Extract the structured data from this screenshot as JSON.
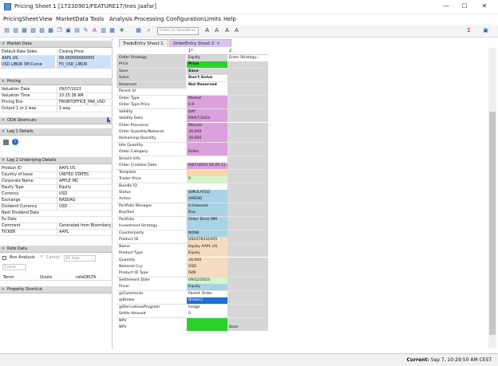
{
  "window": {
    "title": "Pricing Sheet 1 [17230901/FEATURE17/Ines Jaafar]",
    "min": "—",
    "max": "☐",
    "close": "✕"
  },
  "menu": [
    "PricingSheet",
    "View",
    "MarketData",
    "Tools",
    "Analysis",
    "Processing",
    "Configuration",
    "Limits",
    "Help"
  ],
  "toolbar": {
    "search_placeholder": "Order Id / Bundle Id"
  },
  "market_data": {
    "title": "Market Data",
    "header": {
      "k": "Default Rate Sides",
      "v": "Closing Price"
    },
    "rows": [
      {
        "k": "AAPL US",
        "v": "58.000000000000"
      },
      {
        "k": "USD LIBOR 3M Curve",
        "v": "F0_USD_LIBOR"
      }
    ]
  },
  "pricing": {
    "title": "Pricing",
    "rows": [
      {
        "k": "Valuation Date",
        "v": "09/07/2023"
      },
      {
        "k": "Valuation Time",
        "v": "10:25:38 AM"
      },
      {
        "k": "Pricing Env",
        "v": "FRONTOFFICE_PAR_USD"
      },
      {
        "k": "Output 1 or 2 way",
        "v": "1-way"
      }
    ]
  },
  "oda": {
    "title": "ODA Shortcuts"
  },
  "leg1": {
    "title": "Leg 1 Details"
  },
  "leg1u": {
    "title": "Leg 1 Underlying Details",
    "rows": [
      {
        "k": "Product ID",
        "v": "AAPL US"
      },
      {
        "k": "Country of Issue",
        "v": "UNITED STATES"
      },
      {
        "k": "Corporate Name",
        "v": "APPLE INC"
      },
      {
        "k": "Equity Type",
        "v": "Equity"
      },
      {
        "k": "Currency",
        "v": "USD"
      },
      {
        "k": "Exchange",
        "v": "NASDAQ"
      },
      {
        "k": "Dividend Currency",
        "v": "USD"
      },
      {
        "k": "Next Dividend Date",
        "v": ""
      },
      {
        "k": "Ex Date",
        "v": ""
      },
      {
        "k": "Comment",
        "v": "Generated from Bloomberg..."
      },
      {
        "k": "TICKER",
        "v": "AAPL"
      }
    ]
  },
  "rate_data": {
    "title": "Rate Data",
    "run_analysis": "Run Analysis",
    "cancel": "Cancel",
    "all_legs": "All legs",
    "curve": "Curve",
    "cols": [
      "Tenor",
      "Quote",
      "rateDELTA"
    ]
  },
  "property_shortcut": {
    "title": "Property Shortcut"
  },
  "tabs": [
    {
      "label": "TradeEntry Sheet 1"
    },
    {
      "label": "OrderEntry Sheet 2"
    }
  ],
  "grid_header": {
    "c1": "1*",
    "c2": "2"
  },
  "rows": [
    {
      "label": "Order Strategy",
      "value": "Equity",
      "extra": "Enter Strategy..."
    },
    {
      "label": "Price",
      "value": "Price",
      "extra": ""
    },
    {
      "label": "Save",
      "value": "Save",
      "extra": ""
    },
    {
      "label": "Solve",
      "value": "Don't Solve",
      "extra": ""
    },
    {
      "label": "Reserved",
      "value": "Not Reserved",
      "extra": ""
    },
    {
      "label": "Parent Id",
      "value": "",
      "extra": ""
    },
    {
      "label": "Order Type",
      "value": "Market",
      "extra": ""
    },
    {
      "label": "Order Type Price",
      "value": "0.0",
      "extra": ""
    },
    {
      "label": "Validity",
      "value": "DAY",
      "extra": ""
    },
    {
      "label": "Validity Date",
      "value": "09/07/2023",
      "extra": ""
    },
    {
      "label": "Order Processor",
      "value": "Manual",
      "extra": ""
    },
    {
      "label": "Order Quantity/Notional",
      "value": "30,000",
      "extra": ""
    },
    {
      "label": "Remaining Quantity",
      "value": "30,000",
      "extra": ""
    },
    {
      "label": "Idle Quantity",
      "value": "",
      "extra": ""
    },
    {
      "label": "Order Category",
      "value": "Order",
      "extra": ""
    },
    {
      "label": "Breach Info",
      "value": "",
      "extra": ""
    },
    {
      "label": "Order Creation Date",
      "value": "9/07/2023 10:25:11 AM",
      "extra": ""
    },
    {
      "label": "Template",
      "value": "",
      "extra": ""
    },
    {
      "label": "Trader Price",
      "value": "0",
      "extra": ""
    },
    {
      "label": "Bundle ID",
      "value": "",
      "extra": ""
    },
    {
      "label": "Status",
      "value": "SIMULATED",
      "extra": ""
    },
    {
      "label": "Action",
      "value": "AMEND",
      "extra": ""
    },
    {
      "label": "Portfolio Manager",
      "value": "O Edwards",
      "extra": ""
    },
    {
      "label": "Buy/Sell",
      "value": "Buy",
      "extra": ""
    },
    {
      "label": "Portfolio",
      "value": "Order Book MM",
      "extra": ""
    },
    {
      "label": "Investment Strategy",
      "value": "",
      "extra": ""
    },
    {
      "label": "Counterparty",
      "value": "NONE",
      "extra": ""
    },
    {
      "label": "Product ID",
      "value": "US0378331005",
      "extra": ""
    },
    {
      "label": "Name",
      "value": "Equity AAPL US",
      "extra": ""
    },
    {
      "label": "Product Type",
      "value": "Equity",
      "extra": ""
    },
    {
      "label": "Quantity",
      "value": "30,000",
      "extra": ""
    },
    {
      "label": "Notional Ccy",
      "value": "USD",
      "extra": ""
    },
    {
      "label": "Product ID Type",
      "value": "ISIN",
      "extra": ""
    },
    {
      "label": "Settlement Date",
      "value": "09/12/2023",
      "extra": ""
    },
    {
      "label": "Pricer",
      "value": "Equity",
      "extra": ""
    },
    {
      "label": "@Comments",
      "value": "Parent Order",
      "extra": ""
    },
    {
      "label": "@Broker",
      "value": "Broker2",
      "extra": ""
    },
    {
      "label": "@DerivativesProgram",
      "value": "hedge",
      "extra": ""
    },
    {
      "label": "Settle Amount",
      "value": "0",
      "extra": ""
    },
    {
      "label": "NPV",
      "value": "",
      "extra": ""
    },
    {
      "label": "NPV",
      "value": "",
      "extra": "Base"
    }
  ],
  "row_colors": [
    "#d6d6d6",
    "#2bd12b",
    "#d6d6d6",
    "#ffffff",
    "#ffffff",
    "#ffffff",
    "#dca0dc",
    "#dca0dc",
    "#dca0dc",
    "#dca0dc",
    "#dca0dc",
    "#dca0dc",
    "#dca0dc",
    "#dca0dc",
    "#dca0dc",
    "#ffffff",
    "#dca0dc",
    "#f7d6a8",
    "#d3f5c8",
    "#ffffff",
    "#a8d3e6",
    "#a8d3e6",
    "#a8d3e6",
    "#a8d3e6",
    "#a8d3e6",
    "#a8d3e6",
    "#a8d3e6",
    "#f5dcc0",
    "#f5dcc0",
    "#f5dcc0",
    "#f5dcc0",
    "#f5dcc0",
    "#f5dcc0",
    "#d3f5c8",
    "#a8d3e6",
    "#ffffff",
    "#1e6fd6",
    "#ffffff",
    "#ffffff",
    "#2bd12b",
    "#2bd12b"
  ],
  "status": {
    "text": "Current:",
    "value": "Sep 7, 10:29:50 AM CEST"
  }
}
